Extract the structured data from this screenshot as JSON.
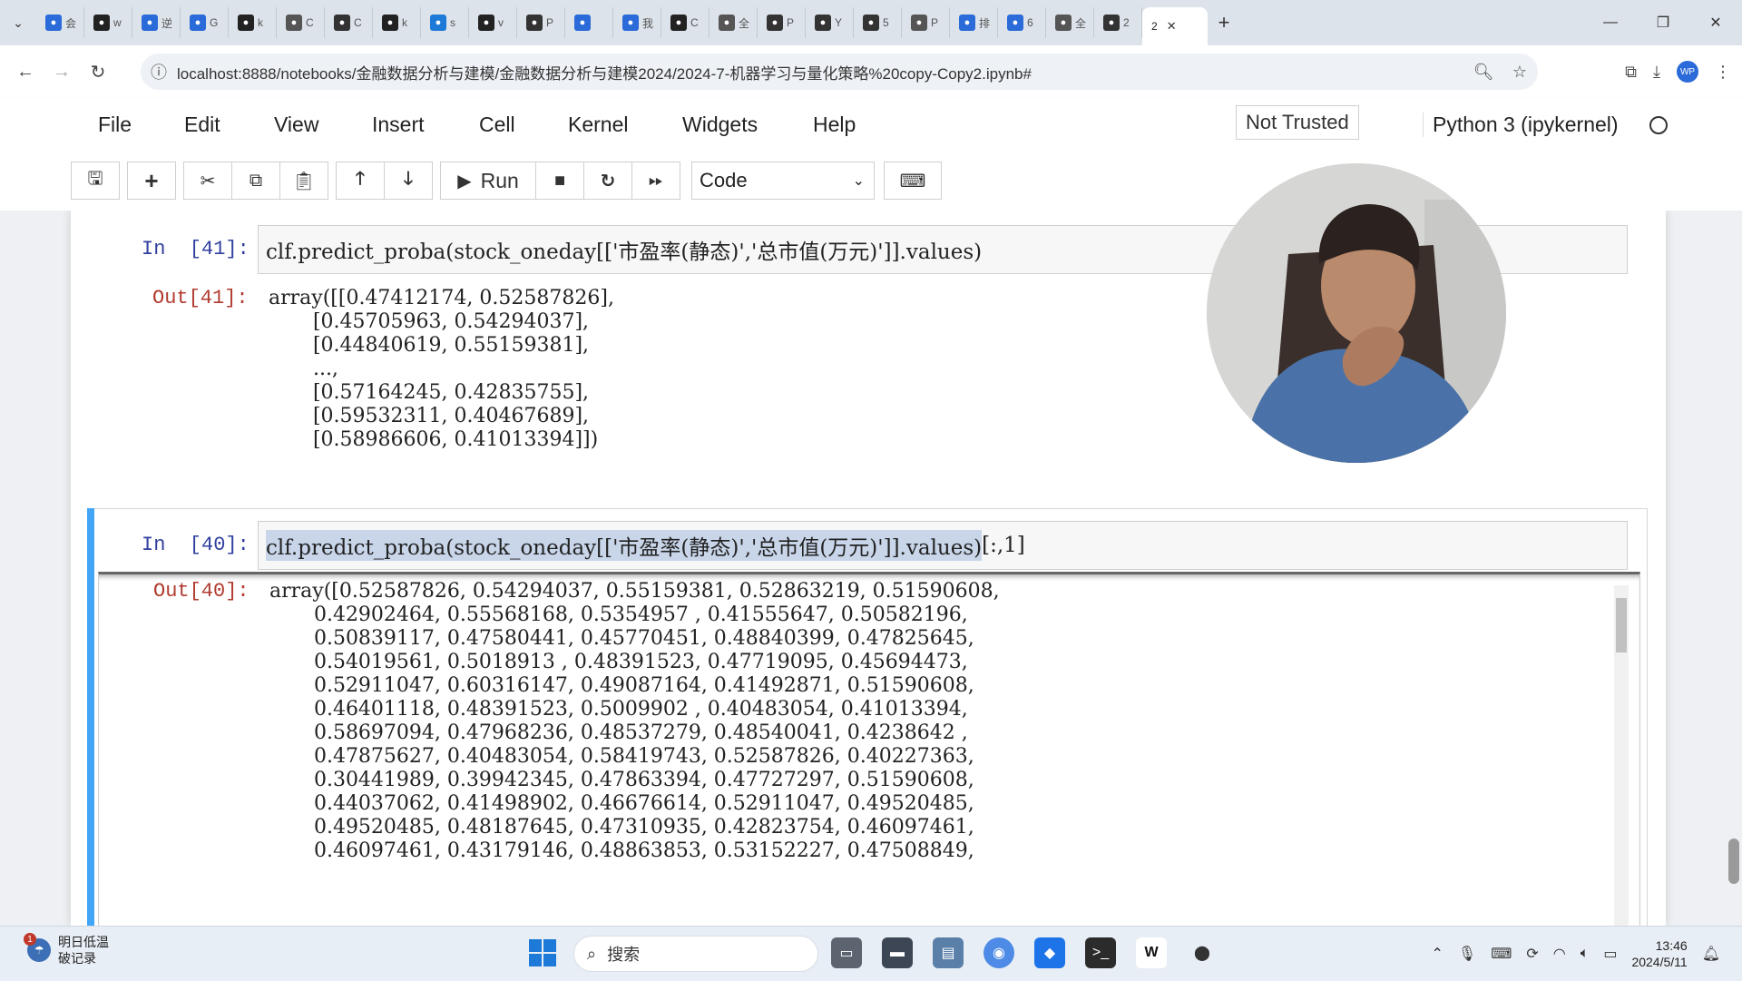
{
  "browser": {
    "tabs": [
      {
        "icon": "calendar-icon",
        "label": "会",
        "color": "#2a6ad9"
      },
      {
        "icon": "github-icon",
        "label": "w",
        "color": "#222222"
      },
      {
        "icon": "translate-icon",
        "label": "逆",
        "color": "#2a6ad9"
      },
      {
        "icon": "doc-icon",
        "label": "G",
        "color": "#2a6ad9"
      },
      {
        "icon": "github-icon",
        "label": "k",
        "color": "#222222"
      },
      {
        "icon": "cube-icon",
        "label": "C",
        "color": "#555555"
      },
      {
        "icon": "mail-icon",
        "label": "C",
        "color": "#333333"
      },
      {
        "icon": "github-icon",
        "label": "k",
        "color": "#222222"
      },
      {
        "icon": "zhihu-icon",
        "label": "s",
        "color": "#1e7ad8"
      },
      {
        "icon": "github-icon",
        "label": "v",
        "color": "#222222"
      },
      {
        "icon": "c-icon",
        "label": "P",
        "color": "#333333"
      },
      {
        "icon": "cloud-icon",
        "label": "",
        "color": "#2a6ad9"
      },
      {
        "icon": "cloud-icon",
        "label": "我",
        "color": "#2a6ad9"
      },
      {
        "icon": "github-icon",
        "label": "C",
        "color": "#222222"
      },
      {
        "icon": "loading-icon",
        "label": "全",
        "color": "#555555"
      },
      {
        "icon": "cap-icon",
        "label": "P",
        "color": "#333333"
      },
      {
        "icon": "youtube-icon",
        "label": "Y",
        "color": "#333333"
      },
      {
        "icon": "o-icon",
        "label": "5",
        "color": "#333333"
      },
      {
        "icon": "google-icon",
        "label": "P",
        "color": "#555555"
      },
      {
        "icon": "calendar-icon",
        "label": "排",
        "color": "#2a6ad9"
      },
      {
        "icon": "chart-icon",
        "label": "6",
        "color": "#2a6ad9"
      },
      {
        "icon": "loading-icon",
        "label": "全",
        "color": "#555555"
      },
      {
        "icon": "note-icon",
        "label": "2",
        "color": "#333333"
      }
    ],
    "active_tab_label": "2",
    "url": "localhost:8888/notebooks/金融数据分析与建模/金融数据分析与建模2024/2024-7-机器学习与量化策略%20copy-Copy2.ipynb#"
  },
  "jupyter": {
    "menu": [
      "File",
      "Edit",
      "View",
      "Insert",
      "Cell",
      "Kernel",
      "Widgets",
      "Help"
    ],
    "trust_status": "Not Trusted",
    "kernel": "Python 3 (ipykernel)",
    "toolbar": {
      "run_label": "Run",
      "cell_type": "Code"
    }
  },
  "cells": [
    {
      "in_prompt": "In  [41]:",
      "code": "clf.predict_proba(stock_oneday[['市盈率(静态)','总市值(万元)']].values)",
      "out_prompt": "Out[41]:",
      "output": "array([[0.47412174, 0.52587826],\n       [0.45705963, 0.54294037],\n       [0.44840619, 0.55159381],\n       ...,\n       [0.57164245, 0.42835755],\n       [0.59532311, 0.40467689],\n       [0.58986606, 0.41013394]])"
    },
    {
      "in_prompt": "In  [40]:",
      "code": "clf.predict_proba(stock_oneday[['市盈率(静态)','总市值(万元)']].values)",
      "code_suffix": "[:,1]",
      "out_prompt": "Out[40]:",
      "output": "array([0.52587826, 0.54294037, 0.55159381, 0.52863219, 0.51590608,\n       0.42902464, 0.55568168, 0.5354957 , 0.41555647, 0.50582196,\n       0.50839117, 0.47580441, 0.45770451, 0.48840399, 0.47825645,\n       0.54019561, 0.5018913 , 0.48391523, 0.47719095, 0.45694473,\n       0.52911047, 0.60316147, 0.49087164, 0.41492871, 0.51590608,\n       0.46401118, 0.48391523, 0.5009902 , 0.40483054, 0.41013394,\n       0.58697094, 0.47968236, 0.48537279, 0.48540041, 0.4238642 ,\n       0.47875627, 0.40483054, 0.58419743, 0.52587826, 0.40227363,\n       0.30441989, 0.39942345, 0.47863394, 0.47727297, 0.51590608,\n       0.44037062, 0.41498902, 0.46676614, 0.52911047, 0.49520485,\n       0.49520485, 0.48187645, 0.47310935, 0.42823754, 0.46097461,\n       0.46097461, 0.43179146, 0.48863853, 0.53152227, 0.47508849,"
    }
  ],
  "taskbar": {
    "weather_badge": "1",
    "weather_line1": "明日低温",
    "weather_line2": "破记录",
    "search_placeholder": "搜索",
    "time": "13:46",
    "date": "2024/5/11"
  }
}
